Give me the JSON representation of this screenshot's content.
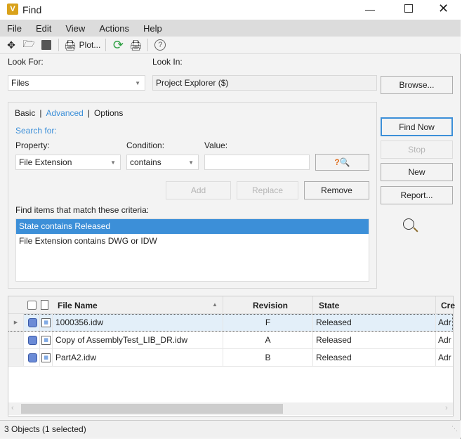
{
  "window": {
    "title": "Find",
    "app_icon": "V"
  },
  "menu": [
    "File",
    "Edit",
    "View",
    "Actions",
    "Help"
  ],
  "toolbar": {
    "plot_label": "Plot..."
  },
  "look_for": {
    "label": "Look For:",
    "value": "Files"
  },
  "look_in": {
    "label": "Look In:",
    "value": "Project Explorer ($)"
  },
  "buttons": {
    "browse": "Browse...",
    "find_now": "Find Now",
    "stop": "Stop",
    "new": "New",
    "report": "Report...",
    "add": "Add",
    "replace": "Replace",
    "remove": "Remove"
  },
  "tabs": [
    {
      "label": "Basic"
    },
    {
      "label": "Advanced",
      "active": true
    },
    {
      "label": "Options"
    }
  ],
  "search_for": "Search for:",
  "property": {
    "label": "Property:",
    "value": "File Extension"
  },
  "condition": {
    "label": "Condition:",
    "value": "contains"
  },
  "value": {
    "label": "Value:",
    "value": ""
  },
  "criteria": {
    "label": "Find items that match these criteria:",
    "items": [
      "State contains Released",
      "File Extension contains DWG or IDW"
    ],
    "selected": 0
  },
  "grid": {
    "columns": [
      "File Name",
      "Revision",
      "State",
      "Cre"
    ],
    "rows": [
      {
        "name": "1000356.idw",
        "revision": "F",
        "state": "Released",
        "created": "Adr",
        "selected": true
      },
      {
        "name": "Copy of AssemblyTest_LIB_DR.idw",
        "revision": "A",
        "state": "Released",
        "created": "Adr"
      },
      {
        "name": "PartA2.idw",
        "revision": "B",
        "state": "Released",
        "created": "Adr"
      }
    ]
  },
  "status": "3 Objects (1 selected)",
  "colors": {
    "accent": "#3c8fd8",
    "selection": "#3c8fd8"
  }
}
